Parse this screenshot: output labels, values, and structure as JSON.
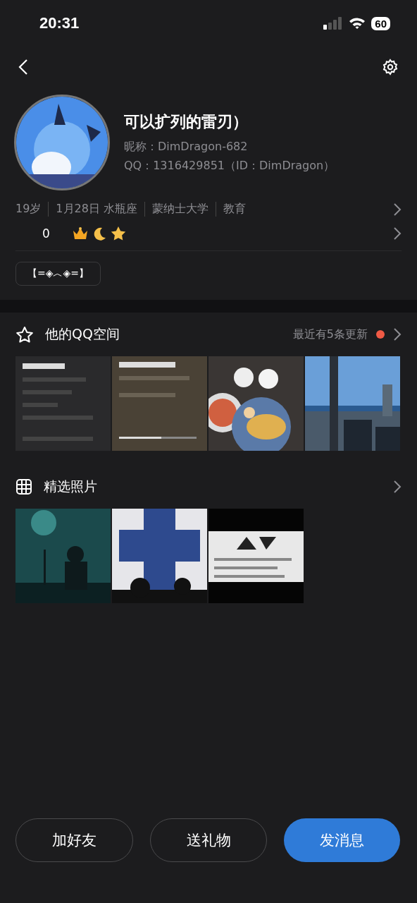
{
  "status_bar": {
    "time": "20:31",
    "battery": "60"
  },
  "profile": {
    "name": "可以扩列的雷刃）",
    "nickname": "昵称：DimDragon-682",
    "qq": "QQ：1316429851（ID：DimDragon）"
  },
  "info": [
    "19岁",
    "1月28日 水瓶座",
    "蒙纳士大学",
    "教育"
  ],
  "badges": {
    "count": "0"
  },
  "tag": "【=◈︿◈=】",
  "qzone": {
    "title": "他的QQ空间",
    "updates": "最近有5条更新",
    "unread": true
  },
  "featured": {
    "title": "精选照片"
  },
  "actions": [
    {
      "label": "加好友",
      "primary": false
    },
    {
      "label": "送礼物",
      "primary": false
    },
    {
      "label": "发消息",
      "primary": true
    }
  ]
}
